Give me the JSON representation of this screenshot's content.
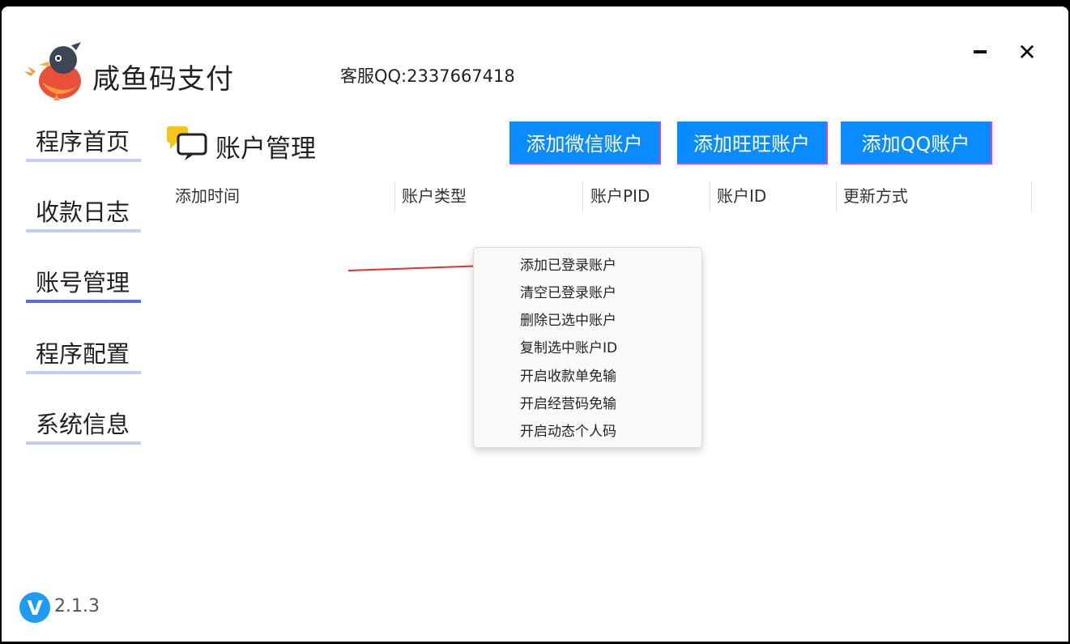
{
  "header": {
    "app_title": "咸鱼码支付",
    "support_text": "客服QQ:2337667418"
  },
  "sidebar": {
    "items": [
      {
        "label": "程序首页"
      },
      {
        "label": "收款日志"
      },
      {
        "label": "账号管理",
        "active": true
      },
      {
        "label": "程序配置"
      },
      {
        "label": "系统信息"
      }
    ]
  },
  "main": {
    "section_title": "账户管理",
    "buttons": {
      "add_wechat": "添加微信账户",
      "add_wangwang": "添加旺旺账户",
      "add_qq": "添加QQ账户"
    },
    "table": {
      "columns": [
        "添加时间",
        "账户类型",
        "账户PID",
        "账户ID",
        "更新方式"
      ],
      "rows": []
    }
  },
  "context_menu": {
    "items": [
      "添加已登录账户",
      "清空已登录账户",
      "删除已选中账户",
      "复制选中账户ID",
      "开启收款单免输",
      "开启经营码免输",
      "开启动态个人码"
    ]
  },
  "footer": {
    "version_icon_letter": "V",
    "version": "2.1.3"
  },
  "colors": {
    "primary_button": "#0a8bff",
    "nav_active_bar": "#5a6fdb",
    "nav_bar": "#c7cdf2",
    "arrow": "#e53030",
    "version_icon": "#1e9bf2"
  }
}
